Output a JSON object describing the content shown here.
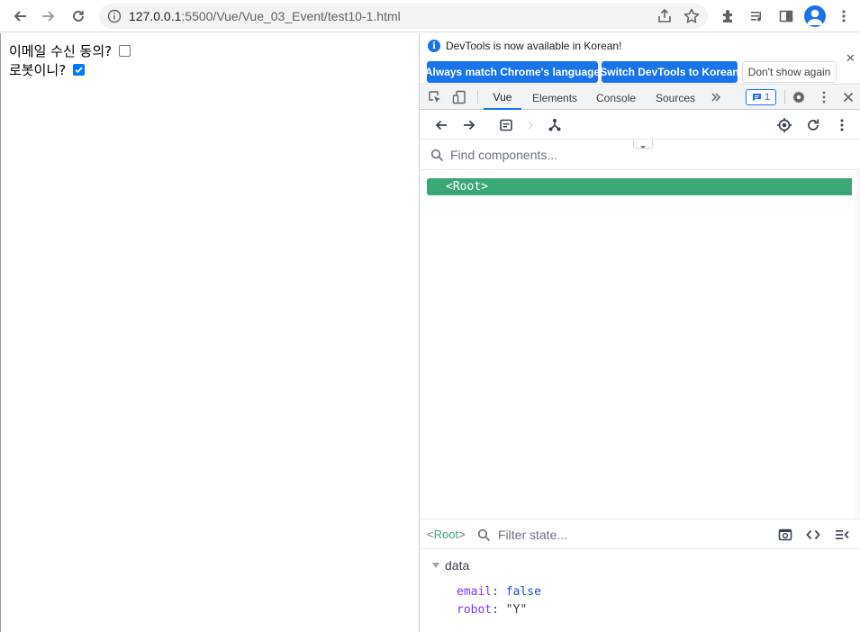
{
  "browser": {
    "url_host": "127.0.0.1",
    "url_path": ":5500/Vue/Vue_03_Event/test10-1.html"
  },
  "page": {
    "rows": [
      {
        "label": "이메일 수신 동의?",
        "checked": false
      },
      {
        "label": "로봇이니?",
        "checked": true
      }
    ]
  },
  "devtools": {
    "infobar": {
      "message": "DevTools is now available in Korean!",
      "btn_match": "Always match Chrome's language",
      "btn_switch": "Switch DevTools to Korean",
      "btn_dismiss": "Don't show again"
    },
    "tabs": [
      {
        "label": "Vue",
        "active": true
      },
      {
        "label": "Elements",
        "active": false
      },
      {
        "label": "Console",
        "active": false
      },
      {
        "label": "Sources",
        "active": false
      }
    ],
    "issues_count": "1",
    "components_search_placeholder": "Find components...",
    "tree_root": "<Root>",
    "state_root": "Root",
    "state_filter_placeholder": "Filter state...",
    "section": "data",
    "state": [
      {
        "key": "email",
        "value": "false",
        "type": "bool"
      },
      {
        "key": "robot",
        "value": "\"Y\"",
        "type": "str"
      }
    ]
  },
  "colors": {
    "accent": "#1a73e8",
    "vue_green": "#3ba776",
    "checkbox_checked": "#0075ff"
  }
}
